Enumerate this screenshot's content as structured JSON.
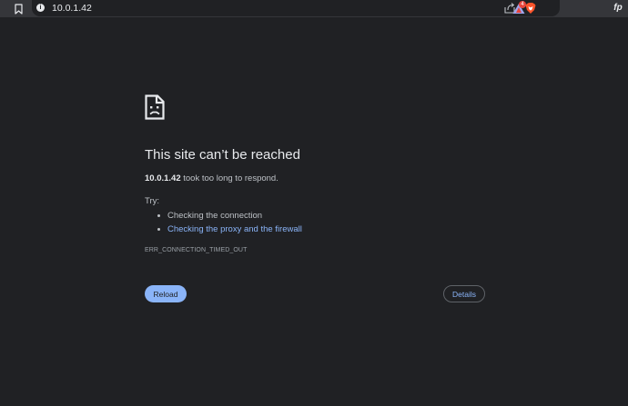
{
  "toolbar": {
    "url": "10.0.1.42",
    "info_icon": "i",
    "badge_count": "4",
    "profile_initials": "fp",
    "icons": [
      "bookmark-icon",
      "info-icon",
      "share-icon",
      "brave-shields-icon",
      "brave-rewards-icon",
      "profile-icon"
    ]
  },
  "error_page": {
    "title": "This site can’t be reached",
    "host": "10.0.1.42",
    "summary_rest": " took too long to respond.",
    "try_label": "Try:",
    "suggestions": [
      {
        "text": "Checking the connection",
        "is_link": false
      },
      {
        "text": "Checking the proxy and the firewall",
        "is_link": true
      }
    ],
    "error_code": "ERR_CONNECTION_TIMED_OUT",
    "reload_label": "Reload",
    "details_label": "Details"
  },
  "colors": {
    "background": "#202124",
    "toolbar": "#35363a",
    "text": "#e8eaed",
    "secondary_text": "#bdc1c6",
    "link": "#8ab4f8",
    "primary_button": "#8ab4f8",
    "brave_orange": "#fb542b",
    "badge_red": "#e8453c"
  }
}
